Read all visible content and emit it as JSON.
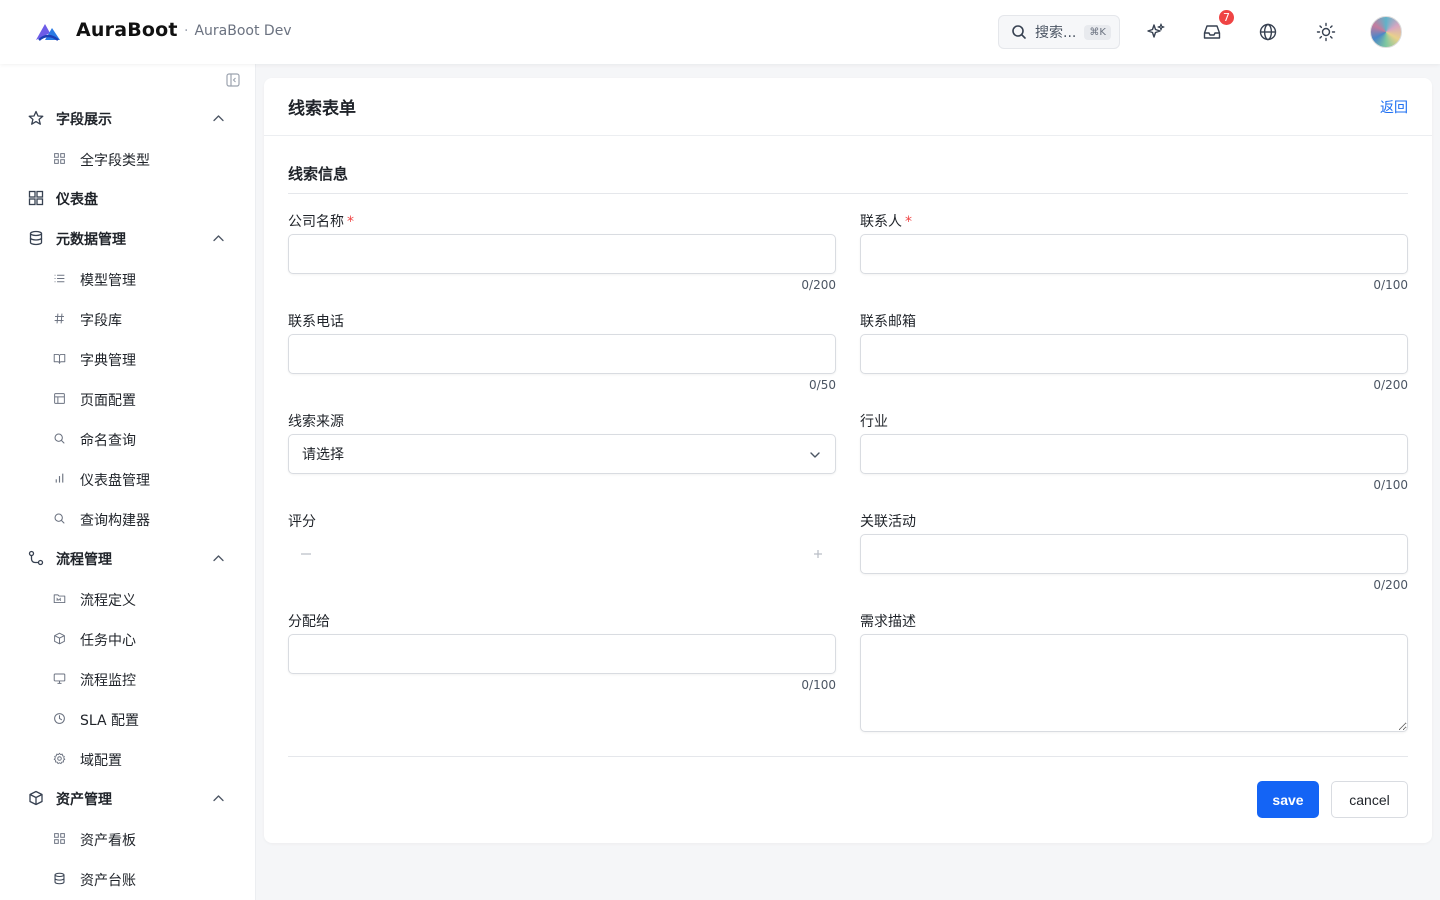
{
  "header": {
    "brand": "AuraBoot",
    "env_separator": "·",
    "env": "AuraBoot Dev",
    "search_placeholder": "搜索...",
    "search_shortcut": "⌘K",
    "notification_count": "7"
  },
  "sidebar": {
    "groups": [
      {
        "label": "字段展示",
        "icon": "star-icon",
        "items": [
          {
            "label": "全字段类型",
            "icon": "grid-icon"
          }
        ]
      },
      {
        "label": "仪表盘",
        "icon": "dashboard-icon",
        "items": []
      },
      {
        "label": "元数据管理",
        "icon": "database-icon",
        "items": [
          {
            "label": "模型管理",
            "icon": "list-icon"
          },
          {
            "label": "字段库",
            "icon": "hash-icon"
          },
          {
            "label": "字典管理",
            "icon": "book-icon"
          },
          {
            "label": "页面配置",
            "icon": "layout-icon"
          },
          {
            "label": "命名查询",
            "icon": "search-icon"
          },
          {
            "label": "仪表盘管理",
            "icon": "bar-chart-icon"
          },
          {
            "label": "查询构建器",
            "icon": "search-icon"
          }
        ]
      },
      {
        "label": "流程管理",
        "icon": "workflow-icon",
        "items": [
          {
            "label": "流程定义",
            "icon": "folder-icon"
          },
          {
            "label": "任务中心",
            "icon": "cube-icon"
          },
          {
            "label": "流程监控",
            "icon": "monitor-icon"
          },
          {
            "label": "SLA 配置",
            "icon": "clock-icon"
          },
          {
            "label": "域配置",
            "icon": "settings-icon"
          }
        ]
      },
      {
        "label": "资产管理",
        "icon": "box-icon",
        "items": [
          {
            "label": "资产看板",
            "icon": "grid-icon"
          },
          {
            "label": "资产台账",
            "icon": "database-icon"
          }
        ]
      }
    ]
  },
  "page": {
    "title": "线索表单",
    "back": "返回",
    "section": "线索信息"
  },
  "form": {
    "company": {
      "label": "公司名称",
      "value": "",
      "counter": "0/200",
      "required": "*"
    },
    "contact": {
      "label": "联系人",
      "value": "",
      "counter": "0/100",
      "required": "*"
    },
    "phone": {
      "label": "联系电话",
      "value": "",
      "counter": "0/50"
    },
    "email": {
      "label": "联系邮箱",
      "value": "",
      "counter": "0/200"
    },
    "source": {
      "label": "线索来源",
      "value": "请选择"
    },
    "industry": {
      "label": "行业",
      "value": "",
      "counter": "0/100"
    },
    "score": {
      "label": "评分",
      "minus": "−",
      "plus": "+"
    },
    "activity": {
      "label": "关联活动",
      "value": "",
      "counter": "0/200"
    },
    "assignee": {
      "label": "分配给",
      "value": "",
      "counter": "0/100"
    },
    "requirement": {
      "label": "需求描述",
      "value": ""
    }
  },
  "actions": {
    "save": "save",
    "cancel": "cancel"
  },
  "colors": {
    "primary": "#1464f5",
    "link": "#1d6ff2",
    "required": "#ef4444",
    "badge": "#ef4444"
  }
}
